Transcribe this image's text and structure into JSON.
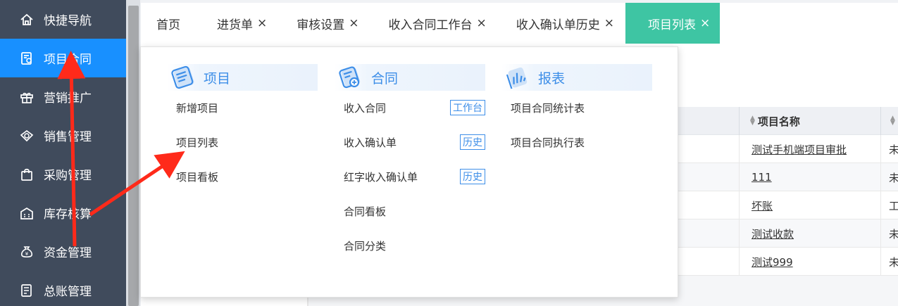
{
  "sidebar": {
    "items": [
      {
        "label": "快捷导航",
        "icon": "home-icon",
        "active": false
      },
      {
        "label": "项目合同",
        "icon": "contract-icon",
        "active": true
      },
      {
        "label": "营销推广",
        "icon": "gift-icon",
        "active": false
      },
      {
        "label": "销售管理",
        "icon": "sales-icon",
        "active": false
      },
      {
        "label": "采购管理",
        "icon": "bag-icon",
        "active": false
      },
      {
        "label": "库存核算",
        "icon": "warehouse-icon",
        "active": false
      },
      {
        "label": "资金管理",
        "icon": "moneybag-icon",
        "active": false
      },
      {
        "label": "总账管理",
        "icon": "ledger-icon",
        "active": false
      }
    ]
  },
  "tabs": [
    {
      "label": "首页",
      "closable": false,
      "active": false
    },
    {
      "label": "进货单",
      "closable": true,
      "active": false
    },
    {
      "label": "审核设置",
      "closable": true,
      "active": false
    },
    {
      "label": "收入合同工作台",
      "closable": true,
      "active": false
    },
    {
      "label": "收入确认单历史",
      "closable": true,
      "active": false
    },
    {
      "label": "项目列表",
      "closable": true,
      "active": true
    }
  ],
  "close_glyph": "×",
  "menu": {
    "columns": [
      {
        "title": "项目",
        "icon": "project-list-icon",
        "items": [
          {
            "label": "新增项目"
          },
          {
            "label": "项目列表"
          },
          {
            "label": "项目看板"
          }
        ]
      },
      {
        "title": "合同",
        "icon": "contract-stack-icon",
        "items": [
          {
            "label": "收入合同",
            "badge": "工作台"
          },
          {
            "label": "收入确认单",
            "badge": "历史"
          },
          {
            "label": "红字收入确认单",
            "badge": "历史"
          },
          {
            "label": "合同看板"
          },
          {
            "label": "合同分类"
          }
        ]
      },
      {
        "title": "报表",
        "icon": "report-chart-icon",
        "items": [
          {
            "label": "项目合同统计表"
          },
          {
            "label": "项目合同执行表"
          }
        ]
      }
    ]
  },
  "table": {
    "headers": [
      "项目名称"
    ],
    "rows": [
      {
        "name": "测试手机端项目审批",
        "status": "未"
      },
      {
        "name": "111",
        "status": "未"
      },
      {
        "name": "坏账",
        "status": "工"
      },
      {
        "name": "测试收款",
        "status": "未"
      },
      {
        "name": "测试999",
        "status": "未"
      }
    ]
  },
  "colors": {
    "sidebar_bg": "#404b5c",
    "active_nav": "#1890ff",
    "active_tab": "#3ec5a3",
    "menu_accent": "#3d8ee8",
    "annotation_arrow": "#ff2a1a"
  }
}
